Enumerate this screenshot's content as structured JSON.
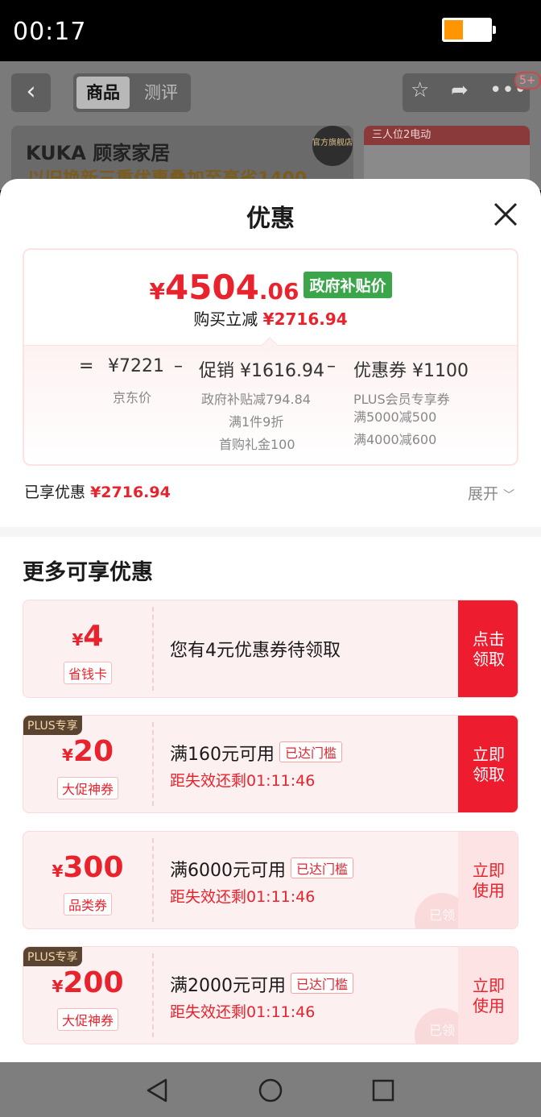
{
  "status": {
    "time": "00:17",
    "battery_level": 0.4,
    "battery_color": "#ff9500"
  },
  "background_page": {
    "tabs": [
      "商品",
      "测评"
    ],
    "badge": "5+",
    "brand": "KUKA 顾家家居",
    "slogan": "以旧换新三重优惠叠加至高省1400",
    "store_badge": "官方旗舰店",
    "side_card_title": "三人位2电动"
  },
  "sheet": {
    "title": "优惠",
    "price": {
      "yen": "¥",
      "integer": "4504",
      "decimal": ".06",
      "tag": "政府补贴价",
      "reduce_label": "购买立减",
      "reduce_amount": "¥2716.94"
    },
    "calc": {
      "eq": "=",
      "jd_price": "¥7221",
      "jd_label": "京东价",
      "minus": "–",
      "promo": "促销 ¥1616.94",
      "promo_details": [
        "政府补贴减794.84",
        "满1件9折",
        "首购礼金100"
      ],
      "coupon": "优惠券 ¥1100",
      "coupon_details": [
        "PLUS会员专享券",
        "满5000减500",
        "满4000减600"
      ]
    },
    "saved_label": "已享优惠",
    "saved_amount": "¥2716.94",
    "expand_label": "展开",
    "more_title": "更多可享优惠",
    "coupons": [
      {
        "yen": "¥",
        "amount": "4",
        "type": "省钱卡",
        "text": "您有4元优惠券待领取",
        "button": "点击领取"
      },
      {
        "plus": "PLUS专享",
        "yen": "¥",
        "amount": "20",
        "type": "大促神券",
        "text": "满160元可用",
        "tag": "已达门槛",
        "expire": "距失效还剩01:11:46",
        "button": "立即领取"
      },
      {
        "yen": "¥",
        "amount": "300",
        "type": "品类券",
        "text": "满6000元可用",
        "tag": "已达门槛",
        "expire": "距失效还剩01:11:46",
        "button": "立即使用",
        "stamp": "已领"
      },
      {
        "plus": "PLUS专享",
        "yen": "¥",
        "amount": "200",
        "type": "大促神券",
        "text": "满2000元可用",
        "tag": "已达门槛",
        "expire": "距失效还剩01:11:46",
        "button": "立即使用",
        "stamp": "已领"
      }
    ]
  },
  "colors": {
    "accent_red": "#e8232d",
    "button_red": "#ed1c2e",
    "gov_green": "#3ba54a"
  }
}
